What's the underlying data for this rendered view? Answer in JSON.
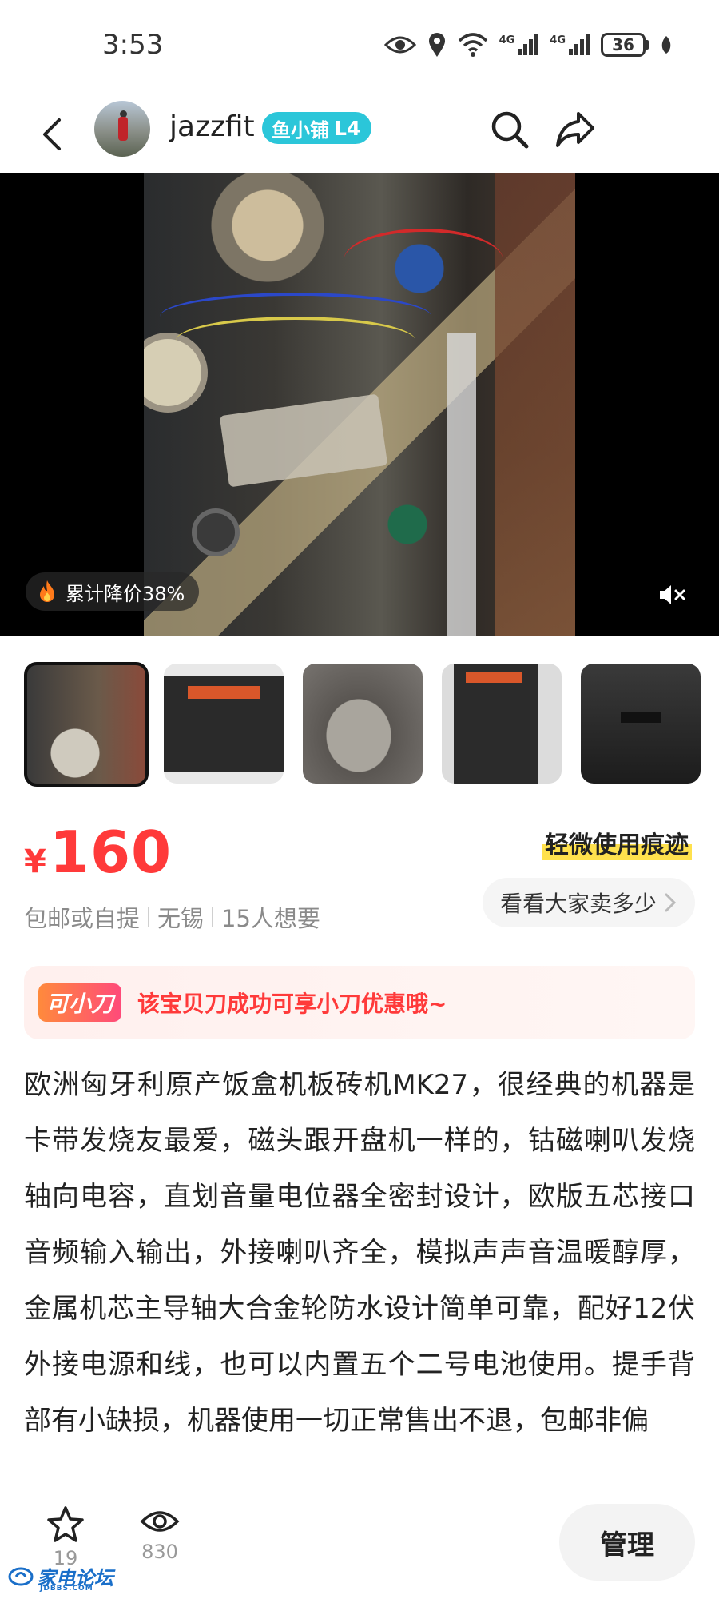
{
  "status_bar": {
    "time": "3:53",
    "battery": "36",
    "signal_1": "4G",
    "signal_2": "4G"
  },
  "header": {
    "username": "jazzfit",
    "shop_badge": "鱼小铺",
    "shop_level": "L4",
    "icons": [
      "back-icon",
      "search-icon",
      "share-icon"
    ]
  },
  "media": {
    "price_drop_badge": "累计降价38%",
    "price_drop_icon": "fire-icon",
    "mute_icon": "mute-icon"
  },
  "thumbnails": {
    "count": 5,
    "selected_index": 0
  },
  "listing": {
    "currency_symbol": "¥",
    "price": "160",
    "condition": "轻微使用痕迹",
    "meta": [
      "包邮或自提",
      "无锡",
      "15人想要"
    ],
    "compare_button": "看看大家卖多少"
  },
  "promo": {
    "logo": "可小刀",
    "text": "该宝贝刀成功可享小刀优惠哦~"
  },
  "description": "欧洲匈牙利原产饭盒机板砖机MK27，很经典的机器是卡带发烧友最爱，磁头跟开盘机一样的，钴磁喇叭发烧轴向电容，直划音量电位器全密封设计，欧版五芯接口音频输入输出，外接喇叭齐全，模拟声声音温暖醇厚，金属机芯主导轴大合金轮防水设计简单可靠，配好12伏外接电源和线，也可以内置五个二号电池使用。提手背部有小缺损，机器使用一切正常售出不退，包邮非偏",
  "bottom_bar": {
    "favorites_count": "19",
    "views_count": "830",
    "manage_button": "管理"
  },
  "watermark": {
    "name": "家电论坛",
    "site": "JDBBS.COM"
  },
  "colors": {
    "price": "#ff3a3a",
    "shop_badge": "#2bc6d9",
    "condition_highlight": "#ffe14d"
  }
}
